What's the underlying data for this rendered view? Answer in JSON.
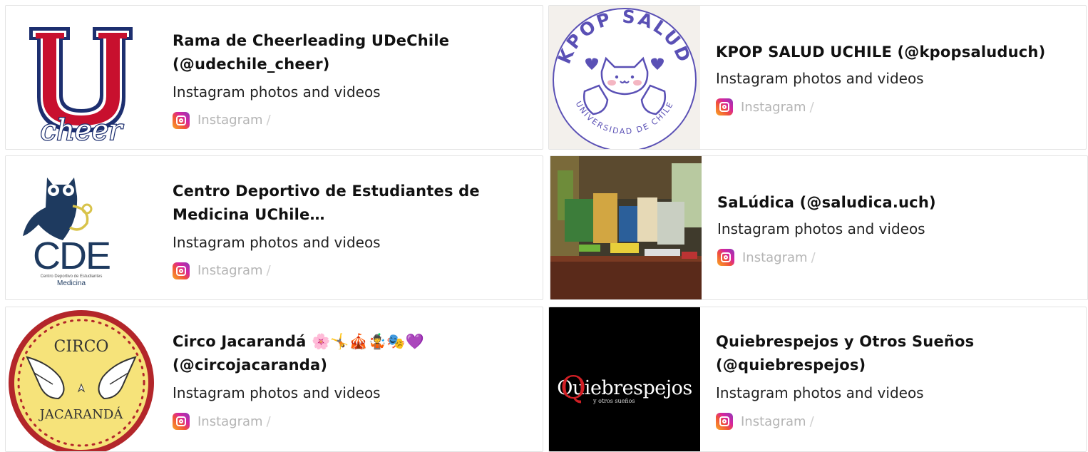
{
  "cards": [
    {
      "title_line1": "Rama de Cheerleading UDeChile",
      "title_line2": "(@udechile_cheer)",
      "description": "Instagram photos and videos",
      "source": "Instagram",
      "separator": "/",
      "thumb_text": "cheer"
    },
    {
      "title_line1": "KPOP SALUD UCHILE (@kpopsaluduch)",
      "title_line2": "",
      "description": "Instagram photos and videos",
      "source": "Instagram",
      "separator": "/",
      "thumb_text_top": "KPOP SALUD",
      "thumb_text_bottom": "UNIVERSIDAD DE CHILE"
    },
    {
      "title_line1": "Centro Deportivo de Estudiantes de",
      "title_line2": "Medicina UChile…",
      "description": "Instagram photos and videos",
      "source": "Instagram",
      "separator": "/",
      "thumb_text": "CDE",
      "thumb_small": "Centro Deportivo de Estudiantes",
      "thumb_sub": "Medicina"
    },
    {
      "title_line1": "SaLúdica (@saludica.uch)",
      "title_line2": "",
      "description": "Instagram photos and videos",
      "source": "Instagram",
      "separator": "/"
    },
    {
      "title_line1": "Circo Jacarandá 🌸🤸🎪🤹🎭💜",
      "title_line2": "(@circojacaranda)",
      "description": "Instagram photos and videos",
      "source": "Instagram",
      "separator": "/",
      "thumb_text_top": "CIRCO",
      "thumb_text_bottom": "JACARANDÁ"
    },
    {
      "title_line1": "Quiebrespejos y Otros Sueños",
      "title_line2": "(@quiebrespejos)",
      "description": "Instagram photos and videos",
      "source": "Instagram",
      "separator": "/",
      "thumb_text": "Quiebrespejos",
      "thumb_sub": "y otros sueños"
    }
  ],
  "colors": {
    "border": "#e3e3e3",
    "source_text": "#b4b4b4",
    "u_red": "#c8102e",
    "u_blue": "#1d2f6f",
    "kpop_purple": "#5a50b5",
    "cde_blue": "#1e3a5f",
    "circo_red": "#b3262a",
    "circo_yellow": "#f6e37a"
  }
}
